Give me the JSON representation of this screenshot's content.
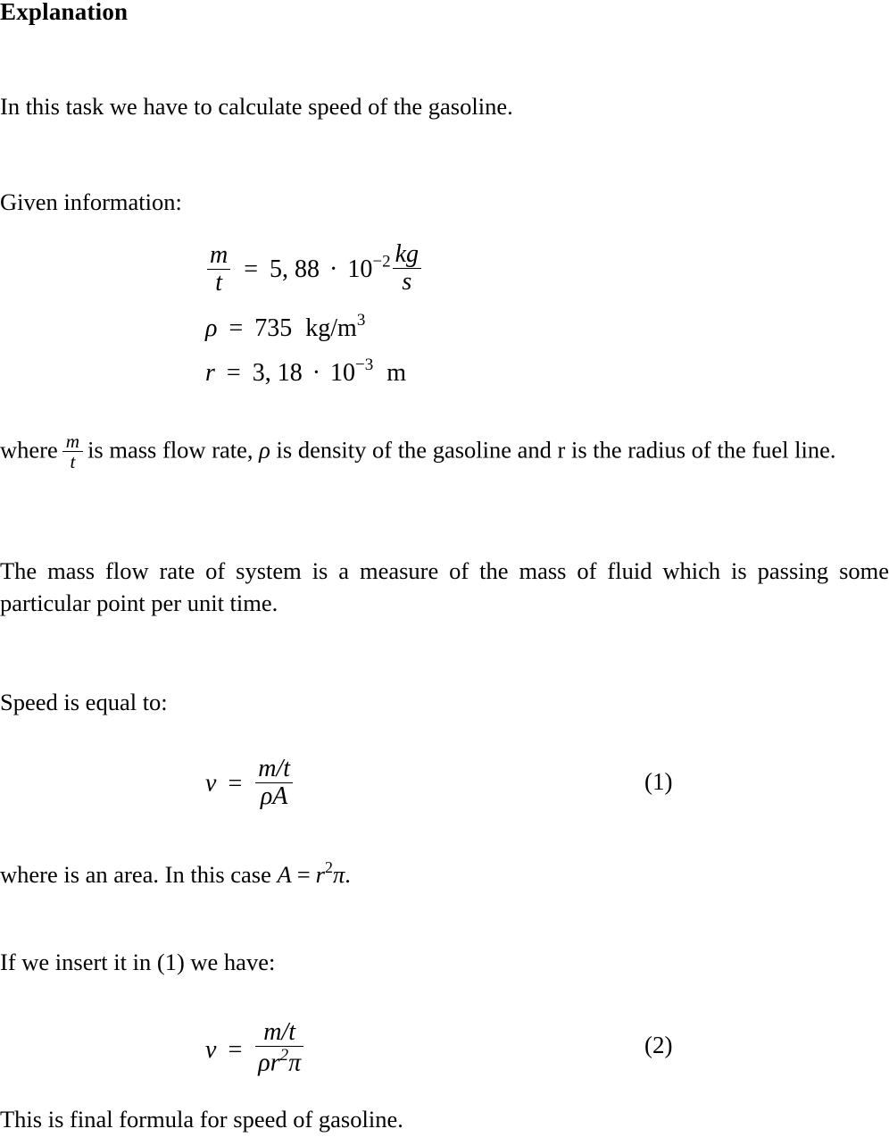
{
  "document": {
    "heading": "Explanation",
    "intro_paragraph": "In this task we have to calculate speed of the gasoline.",
    "given_label": "Given information:",
    "given": {
      "mass_flow_rate": {
        "lhs_num": "m",
        "lhs_den": "t",
        "equals": "=",
        "value": "5, 88",
        "dot": "·",
        "base": "10",
        "exponent": "−2",
        "unit_num": "kg",
        "unit_den": "s"
      },
      "density": {
        "symbol": "ρ",
        "equals": "=",
        "value": "735",
        "unit": "kg/m",
        "unit_exponent": "3"
      },
      "radius": {
        "symbol": "r",
        "equals": "=",
        "value": "3, 18",
        "dot": "·",
        "base": "10",
        "exponent": "−3",
        "unit": "m"
      }
    },
    "where_paragraph": {
      "part1": "where",
      "frac_num": "m",
      "frac_den": "t",
      "part2": "is mass flow rate,",
      "rho": "ρ",
      "part3": "is density of the gasoline and r is the radius of the fuel line."
    },
    "mass_flow_definition": "The mass flow rate of system is a measure of the mass of fluid which is passing some particular point per unit time.",
    "speed_label": "Speed is equal to:",
    "equation_1": {
      "lhs": "v",
      "equals": "=",
      "numerator": "m/t",
      "denominator_rho": "ρ",
      "denominator_area": "A",
      "number": "(1)"
    },
    "area_paragraph": {
      "part1": "where is an area. In this case",
      "area_symbol": "A",
      "equals": "=",
      "radius_symbol": "r",
      "radius_exponent": "2",
      "pi": "π",
      "period": "."
    },
    "insert_paragraph": "If we insert it in (1) we have:",
    "equation_2": {
      "lhs": "v",
      "equals": "=",
      "numerator": "m/t",
      "denominator_rho": "ρ",
      "denominator_r": "r",
      "denominator_exponent": "2",
      "denominator_pi": "π",
      "number": "(2)"
    },
    "final_paragraph": "This is final formula for speed of gasoline."
  },
  "colors": {
    "text": "#000000",
    "background": "#ffffff"
  }
}
